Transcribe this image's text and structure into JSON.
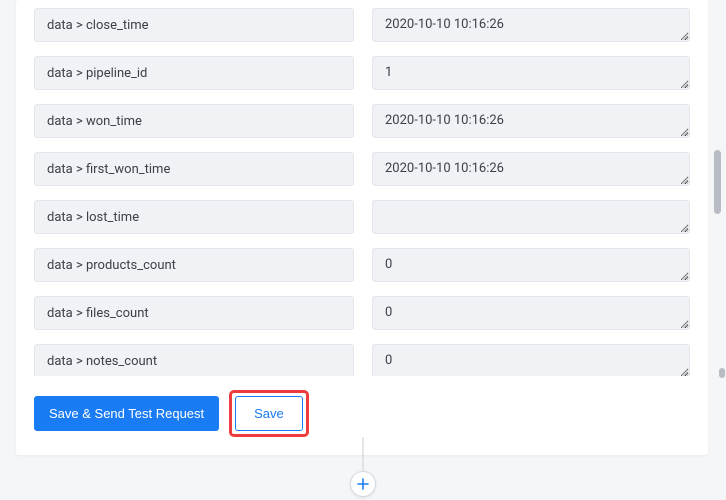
{
  "rows": [
    {
      "key": "data > close_time",
      "value": "2020-10-10 10:16:26"
    },
    {
      "key": "data > pipeline_id",
      "value": "1"
    },
    {
      "key": "data > won_time",
      "value": "2020-10-10 10:16:26"
    },
    {
      "key": "data > first_won_time",
      "value": "2020-10-10 10:16:26"
    },
    {
      "key": "data > lost_time",
      "value": ""
    },
    {
      "key": "data > products_count",
      "value": "0"
    },
    {
      "key": "data > files_count",
      "value": "0"
    },
    {
      "key": "data > notes_count",
      "value": "0"
    }
  ],
  "actions": {
    "primary_label": "Save & Send Test Request",
    "secondary_label": "Save"
  }
}
